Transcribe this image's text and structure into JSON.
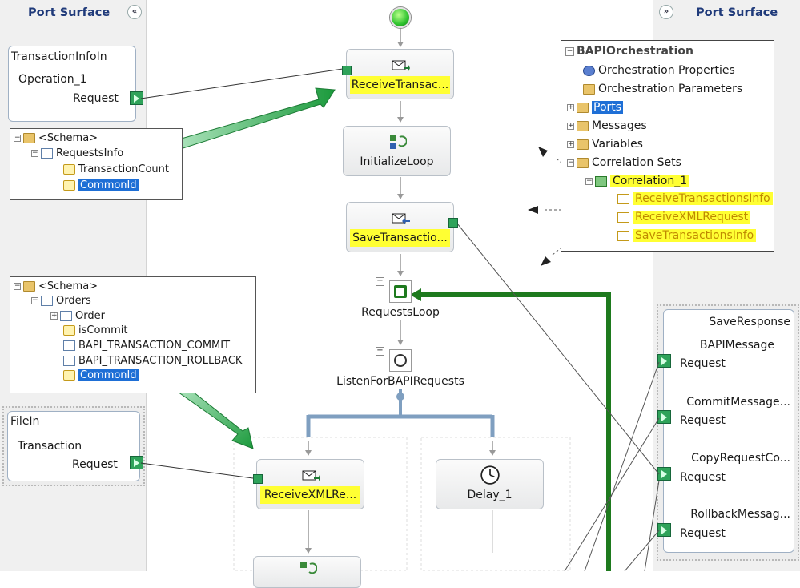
{
  "left_surface": {
    "title": "Port Surface",
    "collapse_glyph": "«",
    "ports": [
      {
        "name": "TransactionInfoIn",
        "operation": "Operation_1",
        "message": "Request"
      },
      {
        "name": "FileIn",
        "operation": "Transaction",
        "message": "Request"
      }
    ]
  },
  "right_surface": {
    "title": "Port Surface",
    "expand_glyph": "»",
    "ports": [
      {
        "name": "SaveResponse",
        "operation": "BAPIMessage",
        "message": "Request"
      },
      {
        "name": "CommitMessage...",
        "message": "Request"
      },
      {
        "name": "CopyRequestCo...",
        "message": "Request"
      },
      {
        "name": "RollbackMessag...",
        "message": "Request"
      }
    ]
  },
  "schema_trees": [
    {
      "items": [
        "<Schema>",
        "RequestsInfo",
        "TransactionCount",
        "CommonId"
      ],
      "selected": "CommonId"
    },
    {
      "items": [
        "<Schema>",
        "Orders",
        "Order",
        "isCommit",
        "BAPI_TRANSACTION_COMMIT",
        "BAPI_TRANSACTION_ROLLBACK",
        "CommonId"
      ],
      "selected": "CommonId"
    }
  ],
  "shapes": {
    "receive1": "ReceiveTransac...",
    "init_loop": "InitializeLoop",
    "save_trans": "SaveTransactio...",
    "requests_loop": "RequestsLoop",
    "listen": "ListenForBAPIRequests",
    "receive_xml": "ReceiveXMLRe...",
    "delay": "Delay_1"
  },
  "orchestration_view": {
    "root": "BAPIOrchestration",
    "items": [
      "Orchestration Properties",
      "Orchestration Parameters",
      "Ports",
      "Messages",
      "Variables",
      "Correlation Sets"
    ],
    "correlation": "Correlation_1",
    "correlation_children": [
      "ReceiveTransactionsInfo",
      "ReceiveXMLRequest",
      "SaveTransactionsInfo"
    ],
    "selected": "Ports"
  },
  "colors": {
    "highlight": "#ffff33",
    "port_green": "#2fa35a",
    "loop_green": "#1e7a1e",
    "branch_blue": "#7f9fc0",
    "selection_blue": "#1e6fd6"
  }
}
